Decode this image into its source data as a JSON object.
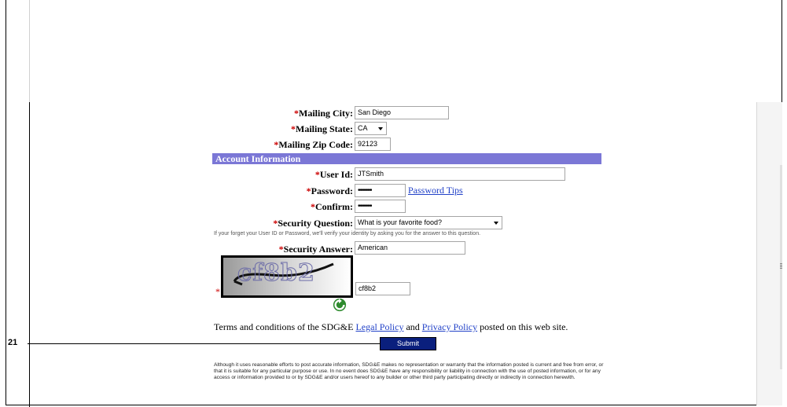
{
  "form": {
    "mailing_city": {
      "label": "Mailing City:",
      "value": "San Diego"
    },
    "mailing_state": {
      "label": "Mailing State:",
      "value": "CA"
    },
    "mailing_zip": {
      "label": "Mailing Zip Code:",
      "value": "92123"
    },
    "section_title": "Account Information",
    "user_id": {
      "label": "User Id:",
      "value": "JTSmith"
    },
    "password": {
      "label": "Password:",
      "value": "•••••••",
      "tips_link": "Password Tips"
    },
    "confirm": {
      "label": "Confirm:",
      "value": "•••••••"
    },
    "security_question": {
      "label": "Security Question:",
      "value": "What is your favorite food?"
    },
    "security_hint": "If your forget your User ID or Password, we'll verify your identity by asking you for the answer to this question.",
    "security_answer": {
      "label": "Security Answer:",
      "value": "American"
    },
    "required_marker": "*",
    "captcha": {
      "image_text": "cf8b2",
      "value": "cf8b2"
    },
    "terms": {
      "prefix": "Terms and conditions of the SDG&E",
      "legal_link": "Legal Policy",
      "middle": "and",
      "privacy_link": "Privacy Policy",
      "suffix": "posted on this web site."
    },
    "submit_label": "Submit",
    "disclaimer": "Although it uses reasonable efforts to post accurate information, SDG&E makes no representation or warranty that the information posted is current and free from error, or that it is suitable for any particular purpose or use. In no event does SDG&E have any responsibility or liability in connection with the use of posted information, or for any access or information provided to or by SDG&E and/or users hereof to any builder or other third party participating directly or indirectly in connection herewith."
  },
  "callout": {
    "number": "21"
  },
  "colors": {
    "section_bar": "#7b77d6",
    "submit_button": "#0a1f7d",
    "required": "#cc0000",
    "link": "#2242c8"
  },
  "icons": {
    "refresh": "refresh-icon",
    "dropdown": "chevron-down-icon"
  }
}
